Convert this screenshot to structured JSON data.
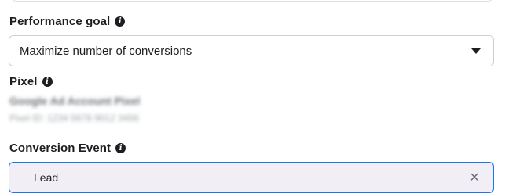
{
  "performance_goal": {
    "label": "Performance goal",
    "info_icon": "info-icon",
    "selected": "Maximize number of conversions",
    "dropdown_icon": "caret-down-icon"
  },
  "pixel": {
    "label": "Pixel",
    "info_icon": "info-icon",
    "name": "Google Ad Account Pixel",
    "id": "Pixel ID: 1234 5678 9012 3456"
  },
  "conversion_event": {
    "label": "Conversion Event",
    "info_icon": "info-icon",
    "value": "Lead",
    "clear_icon": "close-icon"
  },
  "colors": {
    "focus_border": "#1877f2",
    "event_background": "#f1eef6",
    "text": "#1c1e21"
  }
}
